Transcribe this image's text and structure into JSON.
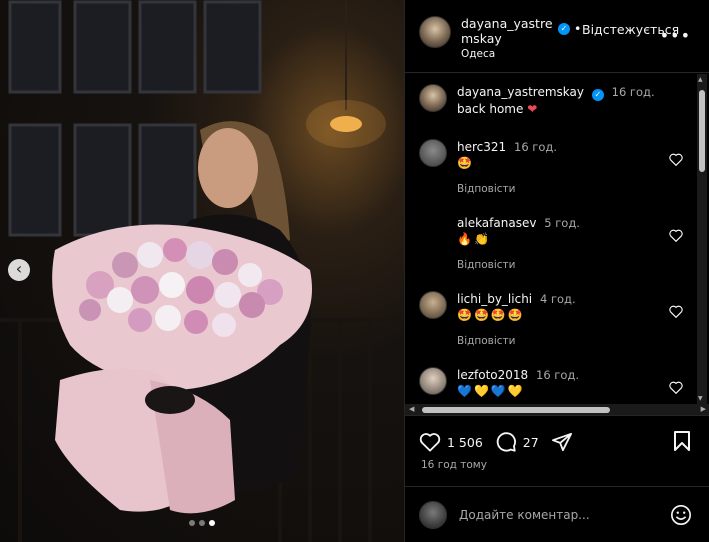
{
  "post": {
    "author": "dayana_yastre​mskay",
    "author_line1": "dayana_yastre",
    "author_line2": "mskay",
    "follow_status": "Відстежується",
    "location": "Одеса",
    "caption_user": "dayana_yastremskay",
    "caption_time": "16 год.",
    "caption_text": "back home",
    "likes": "1 506",
    "comments_count": "27",
    "time_ago": "16 год тому",
    "add_comment_placeholder": "Додайте коментар..."
  },
  "comments": [
    {
      "user": "herc321",
      "time": "16 год.",
      "text": "🤩",
      "reply": "Відповісти"
    },
    {
      "user": "alekafanasev",
      "time": "5 год.",
      "text": "🔥👏",
      "reply": "Відповісти"
    },
    {
      "user": "lichi_by_lichi",
      "time": "4 год.",
      "text": "🤩🤩🤩🤩",
      "reply": "Відповісти"
    },
    {
      "user": "lezfoto2018",
      "time": "16 год.",
      "text": "💙💛💙💛",
      "reply": ""
    }
  ],
  "icons": [
    "heart-icon",
    "comment-icon",
    "share-icon",
    "bookmark-icon",
    "smile-icon",
    "more-icon",
    "chevron-left-icon"
  ],
  "colors": {
    "background": "#000000",
    "secondary_text": "#a8a8a8",
    "verified": "#0095f6",
    "heart": "#ed4956"
  }
}
